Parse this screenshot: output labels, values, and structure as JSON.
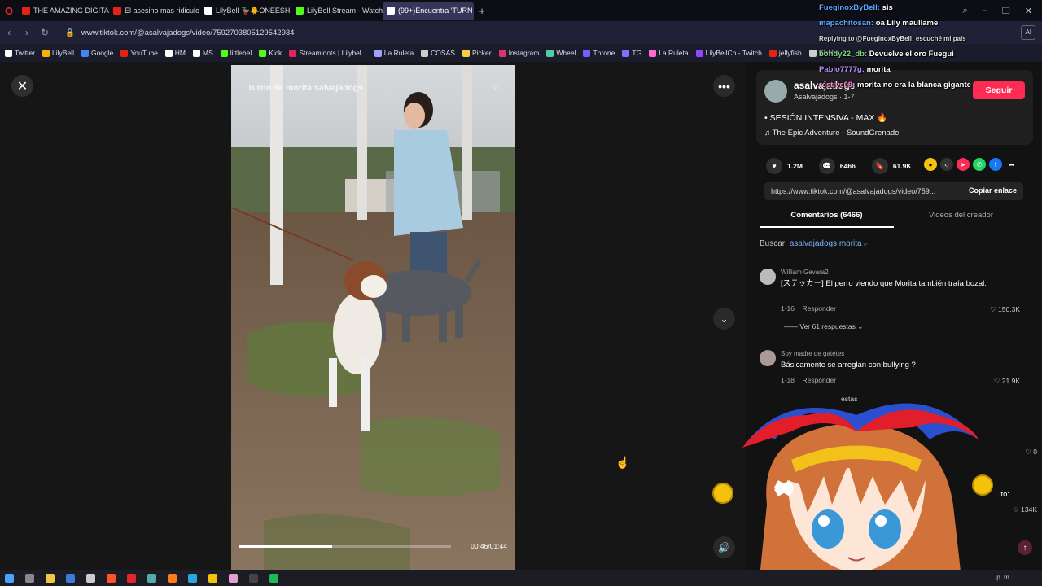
{
  "browser": {
    "tabs": [
      {
        "label": "THE AMAZING DIGITAL CI",
        "color": "#e62117"
      },
      {
        "label": "El asesino mas ridiculo de",
        "color": "#e62117"
      },
      {
        "label": "LilyBell 🦆🐥ONEESHI (@",
        "color": "#ffffff"
      },
      {
        "label": "LilyBell Stream - Watch Li",
        "color": "#53fc18"
      },
      {
        "label": "(99+)Encuentra 'TURN",
        "color": "#ffffff"
      }
    ],
    "url": "www.tiktok.com/@asalvajadogs/video/7592703805129542934",
    "ai_label": "AI",
    "bookmarks": [
      {
        "label": "Twitter",
        "color": "#ffffff"
      },
      {
        "label": "LilyBell",
        "color": "#f4b400"
      },
      {
        "label": "Google",
        "color": "#4285f4"
      },
      {
        "label": "YouTube",
        "color": "#e62117"
      },
      {
        "label": "HM",
        "color": "#ffffff"
      },
      {
        "label": "MS",
        "color": "#ffffff"
      },
      {
        "label": "littlebel",
        "color": "#53fc18"
      },
      {
        "label": "Kick",
        "color": "#53fc18"
      },
      {
        "label": "Streamloots | Lilybel...",
        "color": "#e0245e"
      },
      {
        "label": "La Ruleta",
        "color": "#a0a0ff"
      },
      {
        "label": "COSAS",
        "color": "#cccccc"
      },
      {
        "label": "Picker",
        "color": "#f4d03f"
      },
      {
        "label": "Instagram",
        "color": "#e1306c"
      },
      {
        "label": "Wheel",
        "color": "#4ccfa0"
      },
      {
        "label": "Throne",
        "color": "#7a5cff"
      },
      {
        "label": "TG",
        "color": "#8a6cff"
      },
      {
        "label": "La Ruleta",
        "color": "#ff6ad5"
      },
      {
        "label": "LilyBellCh - Twitch",
        "color": "#9146ff"
      },
      {
        "label": "jellyfish",
        "color": "#e62117"
      },
      {
        "label": "Kicklet",
        "color": "#cccccc"
      }
    ]
  },
  "video": {
    "overlay_title": "Turno de morita salvajadogs",
    "time": "00:46/01:44",
    "progress": 0.44
  },
  "post": {
    "username": "asalvajadogs",
    "subtitle": "Asalvajadogs · 1-7",
    "follow_label": "Seguir",
    "description": "• SESIÓN INTENSIVA - MAX 🔥",
    "music": "The Epic Adventure - SoundGrenade",
    "likes": "1.2M",
    "comments": "6466",
    "saves": "61.9K",
    "link": "https://www.tiktok.com/@asalvajadogs/video/759...",
    "copy_label": "Copiar enlace",
    "tab_comments": "Comentarios (6466)",
    "tab_creator": "Videos del creador",
    "search_prefix": "Buscar:",
    "search_term": "asalvajadogs morita"
  },
  "comments": [
    {
      "author": "William Gevara2",
      "text": "[ステッカー] El perro viendo que Morita también traía bozal:",
      "date": "1-16",
      "reply_label": "Responder",
      "likes": "150.3K",
      "replies": "Ver 61 respuestas"
    },
    {
      "author": "Soy madre de gatetes",
      "text": "Básicamente se arreglan con bullying ?",
      "date": "1-18",
      "reply_label": "Responder",
      "likes": "21.9K",
      "replies": "estas"
    }
  ],
  "partial_likes": [
    "0",
    "134K"
  ],
  "partial_text": "to:",
  "chat": [
    {
      "name": "FueginoxByBell:",
      "msg": "sis",
      "cls": "n1"
    },
    {
      "name": "mapachitosan:",
      "msg": "oa Lily maullame",
      "cls": "n1"
    },
    {
      "name": "",
      "msg": "Replying to @FueginoxByBell: escuché mi país",
      "cls": "n1"
    },
    {
      "name": "bondy22_db:",
      "msg": "Devuelve el oro Fuegui",
      "cls": "n2"
    },
    {
      "name": "Pablo7777g:",
      "msg": "morita",
      "cls": "n3"
    },
    {
      "name": "restive09:",
      "msg": "morita no era la blanca gigante",
      "cls": "n4"
    }
  ],
  "taskbar": {
    "clock": "p. m."
  }
}
